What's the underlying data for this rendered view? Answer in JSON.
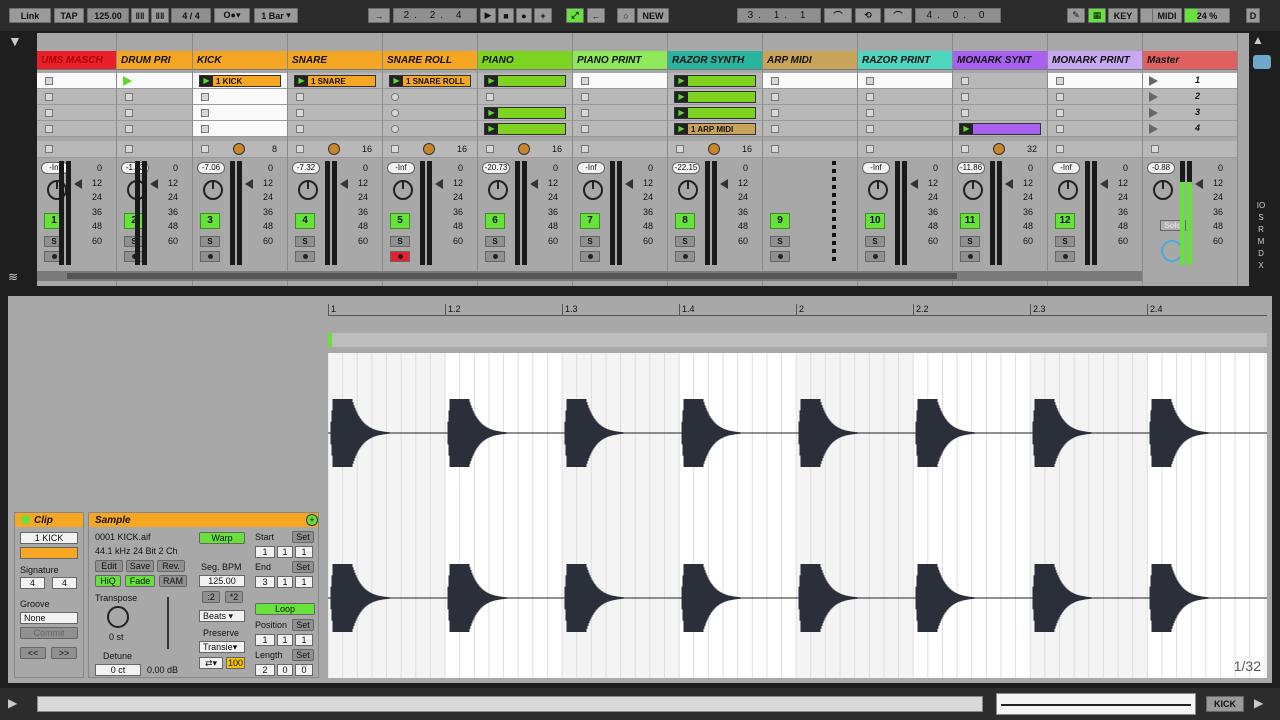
{
  "transport": {
    "link": "Link",
    "tap": "TAP",
    "tempo": "125.00",
    "sig_num": "4",
    "sig_den": "4",
    "quantize": "1 Bar",
    "position": "2. 2. 4",
    "new_label": "NEW",
    "loop_start": "3. 1. 1",
    "loop_length": "4. 0. 0",
    "key": "KEY",
    "midi": "MIDI",
    "cpu": "24 %",
    "disk": "D"
  },
  "tracks": [
    {
      "name": "UMS MASCH",
      "color": "#e8202a",
      "vol": "-Inf",
      "num": "1",
      "head_text_color": "#b00000"
    },
    {
      "name": "DRUM PRI",
      "color": "#f5a623",
      "vol": "-1.93",
      "num": "2"
    },
    {
      "name": "KICK",
      "color": "#f5a623",
      "vol": "-7.06",
      "num": "3",
      "io_count": "8"
    },
    {
      "name": "SNARE",
      "color": "#f5a623",
      "vol": "-7.32",
      "num": "4",
      "io_count": "16"
    },
    {
      "name": "SNARE ROLL",
      "color": "#f5a623",
      "vol": "-Inf",
      "num": "5",
      "io_count": "16"
    },
    {
      "name": "PIANO",
      "color": "#7ed321",
      "vol": "-20.73",
      "num": "6",
      "io_count": "16"
    },
    {
      "name": "PIANO PRINT",
      "color": "#8ee85a",
      "vol": "-Inf",
      "num": "7"
    },
    {
      "name": "RAZOR SYNTH",
      "color": "#2ab39e",
      "vol": "-22.15",
      "num": "8",
      "io_count": "16"
    },
    {
      "name": "ARP MIDI",
      "color": "#c9a35a",
      "vol": "",
      "num": "9"
    },
    {
      "name": "RAZOR PRINT",
      "color": "#4fd6c0",
      "vol": "-Inf",
      "num": "10"
    },
    {
      "name": "MONARK SYNT",
      "color": "#a860f0",
      "vol": "-11.86",
      "num": "11",
      "io_count": "32"
    },
    {
      "name": "MONARK PRINT",
      "color": "#c8a8f0",
      "vol": "-Inf",
      "num": "12"
    },
    {
      "name": "Master",
      "color": "#e06060",
      "vol": "-0.88",
      "num": ""
    }
  ],
  "clips": {
    "kick": "1 KICK",
    "snare": "1 SNARE",
    "snare_roll": "1 SNARE ROLL",
    "arp": "1 ARP MIDI"
  },
  "scenes": [
    "1",
    "2",
    "3",
    "4"
  ],
  "meter_scale": [
    "0",
    "12",
    "24",
    "36",
    "48",
    "60"
  ],
  "solo_label": "S",
  "master_solo": "Solo",
  "ruler": [
    "1",
    "1.2",
    "1.3",
    "1.4",
    "2",
    "2.2",
    "2.3",
    "2.4"
  ],
  "zoom_label": "1/32",
  "clip_panel": {
    "title": "Clip",
    "name": "1 KICK",
    "signature_label": "Signature",
    "sig_num": "4",
    "sig_den": "4",
    "groove_label": "Groove",
    "groove": "None",
    "commit": "Commit"
  },
  "sample_panel": {
    "title": "Sample",
    "file": "0001 KICK.aif",
    "info": "44.1 kHz 24 Bit 2 Ch",
    "edit": "Edit",
    "save": "Save",
    "rev": "Rev.",
    "hiq": "HiQ",
    "fade": "Fade",
    "ram": "RAM",
    "transpose_label": "Transpose",
    "transpose": "0 st",
    "detune_label": "Detune",
    "detune": "0 ct",
    "gain": "0.00 dB",
    "warp": "Warp",
    "seg_bpm_label": "Seg. BPM",
    "seg_bpm": "125.00",
    "half": ":2",
    "double": "*2",
    "warp_mode": "Beats",
    "preserve_label": "Preserve",
    "preserve": "Transie",
    "amount": "100",
    "start_label": "Start",
    "end_label": "End",
    "set": "Set",
    "start": [
      "1",
      "1",
      "1"
    ],
    "end": [
      "3",
      "1",
      "1"
    ],
    "loop": "Loop",
    "position_label": "Position",
    "position": [
      "1",
      "1",
      "1"
    ],
    "length_label": "Length",
    "length": [
      "2",
      "0",
      "0"
    ]
  },
  "status": {
    "track_name": "KICK"
  }
}
